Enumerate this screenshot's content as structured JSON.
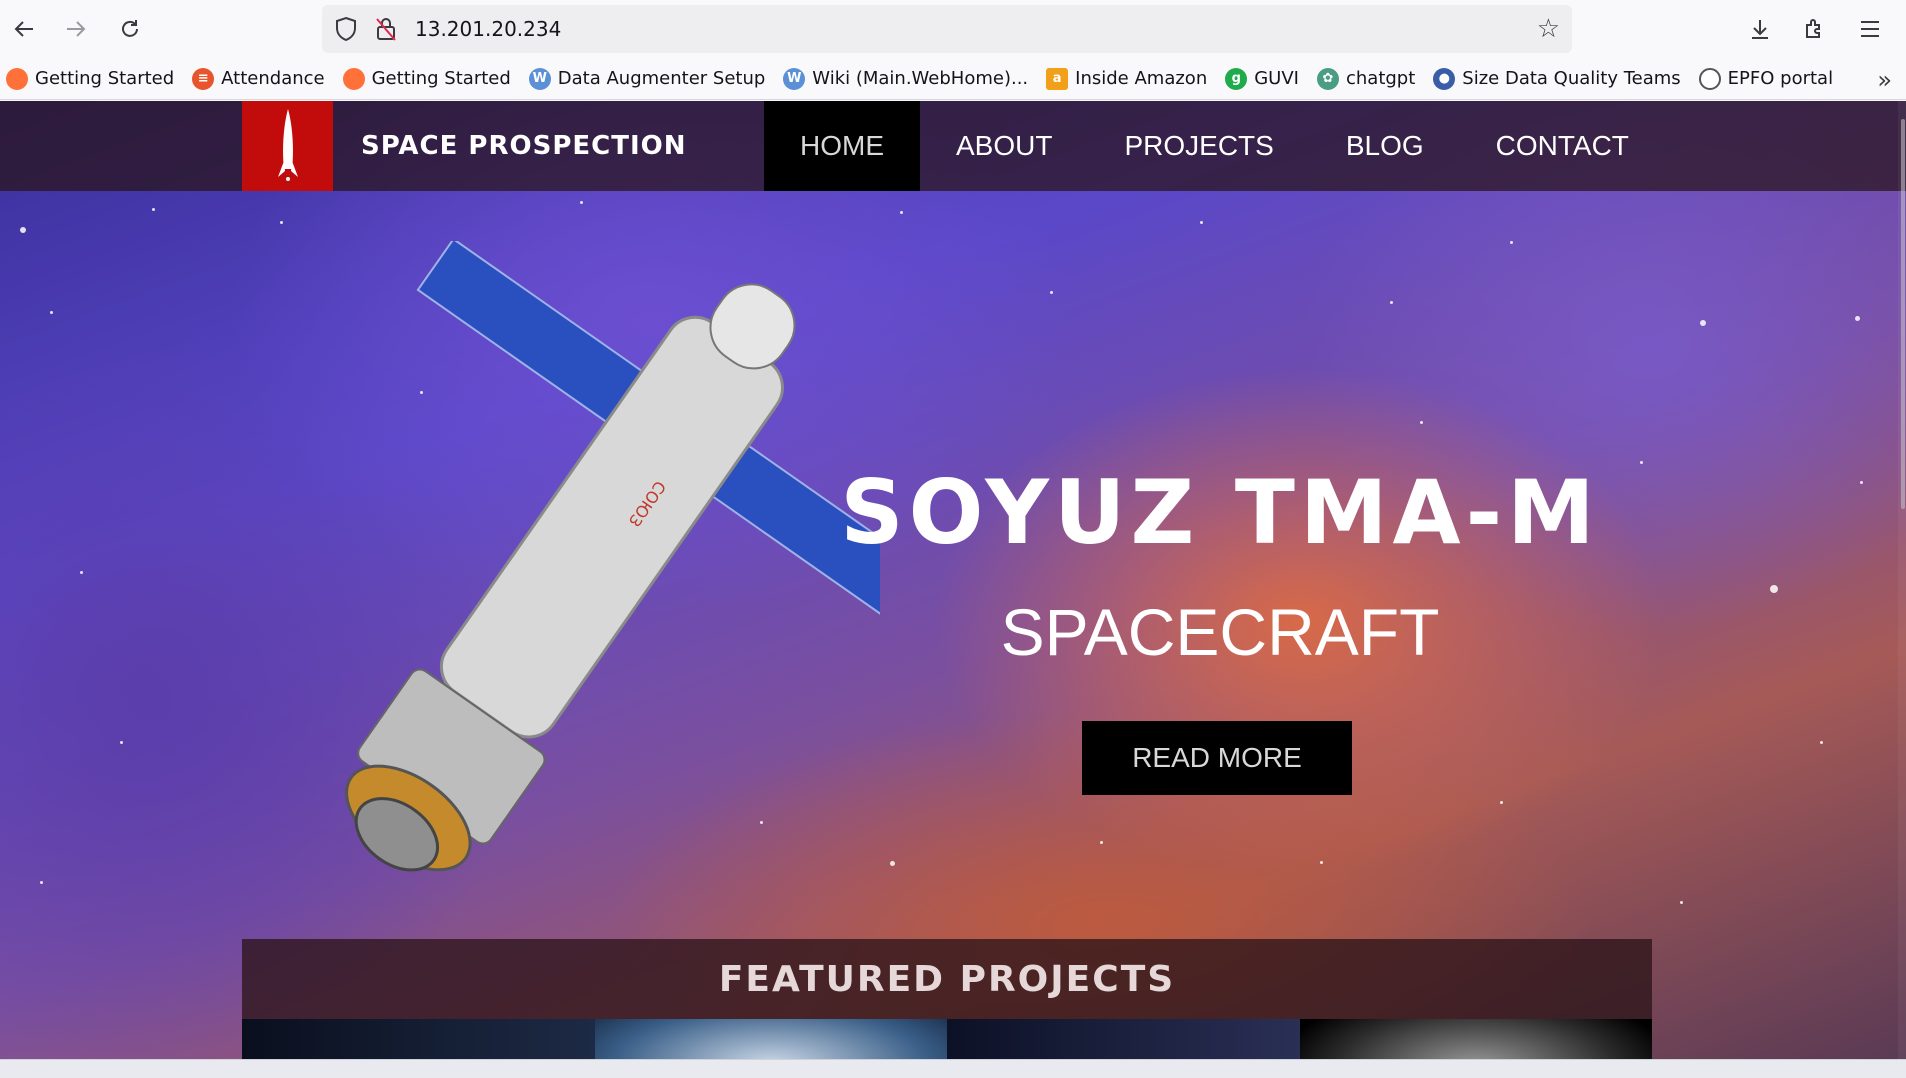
{
  "browser": {
    "url": "13.201.20.234",
    "bookmarks": [
      {
        "label": "Getting Started",
        "icon": "firefox-icon",
        "color": "#ff7139"
      },
      {
        "label": "Attendance",
        "icon": "attendance-icon",
        "color": "#e8552c"
      },
      {
        "label": "Getting Started",
        "icon": "firefox-icon",
        "color": "#ff7139"
      },
      {
        "label": "Data Augmenter Setup",
        "icon": "wiki-icon",
        "color": "#5b8fd6"
      },
      {
        "label": "Wiki (Main.WebHome)...",
        "icon": "wiki-icon",
        "color": "#5b8fd6"
      },
      {
        "label": "Inside Amazon",
        "icon": "amazon-icon",
        "color": "#f2a01a"
      },
      {
        "label": "GUVI",
        "icon": "guvi-icon",
        "color": "#1faa4b"
      },
      {
        "label": "chatgpt",
        "icon": "chatgpt-icon",
        "color": "#4a9d83"
      },
      {
        "label": "Size Data Quality Teams",
        "icon": "person-icon",
        "color": "#3a5da8"
      },
      {
        "label": "EPFO portal",
        "icon": "globe-icon",
        "color": "#555555"
      }
    ]
  },
  "site": {
    "logo_text": "SPACE PROSPECTION",
    "nav": [
      {
        "label": "HOME",
        "active": true
      },
      {
        "label": "ABOUT",
        "active": false
      },
      {
        "label": "PROJECTS",
        "active": false
      },
      {
        "label": "BLOG",
        "active": false
      },
      {
        "label": "CONTACT",
        "active": false
      }
    ],
    "hero": {
      "title": "SOYUZ TMA-M",
      "subtitle": "SPACECRAFT",
      "button": "READ MORE"
    },
    "featured_title": "FEATURED PROJECTS"
  },
  "colors": {
    "logo_red": "#c20c0c",
    "header_bg": "#28141a",
    "active_nav_bg": "#000000"
  }
}
